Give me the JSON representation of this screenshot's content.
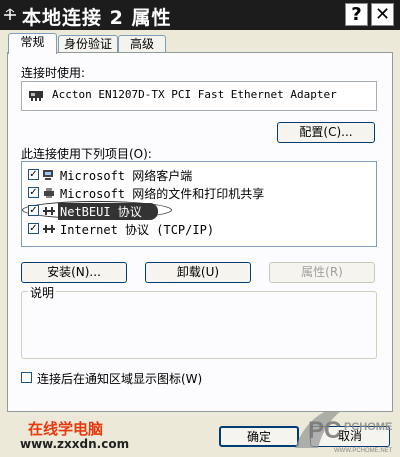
{
  "window": {
    "title": "本地连接 2 属性",
    "help_label": "?",
    "close_label": "✕"
  },
  "tabs": [
    {
      "label": "常规",
      "active": true
    },
    {
      "label": "身份验证",
      "active": false
    },
    {
      "label": "高级",
      "active": false
    }
  ],
  "general": {
    "connect_using_label": "连接时使用:",
    "adapter_name": "Accton EN1207D-TX PCI Fast Ethernet Adapter",
    "configure_label": "配置(C)...",
    "items_label": "此连接使用下列项目(O):",
    "items": [
      {
        "label": "Microsoft 网络客户端",
        "checked": true,
        "icon": "network-client-icon"
      },
      {
        "label": "Microsoft 网络的文件和打印机共享",
        "checked": true,
        "icon": "printer-share-icon"
      },
      {
        "label": "NetBEUI 协议",
        "checked": true,
        "icon": "protocol-icon",
        "highlighted": true
      },
      {
        "label": "Internet 协议 (TCP/IP)",
        "checked": true,
        "icon": "protocol-icon"
      }
    ],
    "install_label": "安装(N)...",
    "uninstall_label": "卸载(U)",
    "properties_label": "属性(R)",
    "description_label": "说明",
    "show_icon_label": "连接后在通知区域显示图标(W)",
    "show_icon_checked": false
  },
  "footer": {
    "ok_label": "确定",
    "cancel_label": "取消"
  },
  "watermarks": {
    "site_name": "在线学电脑",
    "site_url": "www.zxxdn.com",
    "logo_text": "PCHOME",
    "logo_url": "WWW.PCHOME.NET"
  }
}
